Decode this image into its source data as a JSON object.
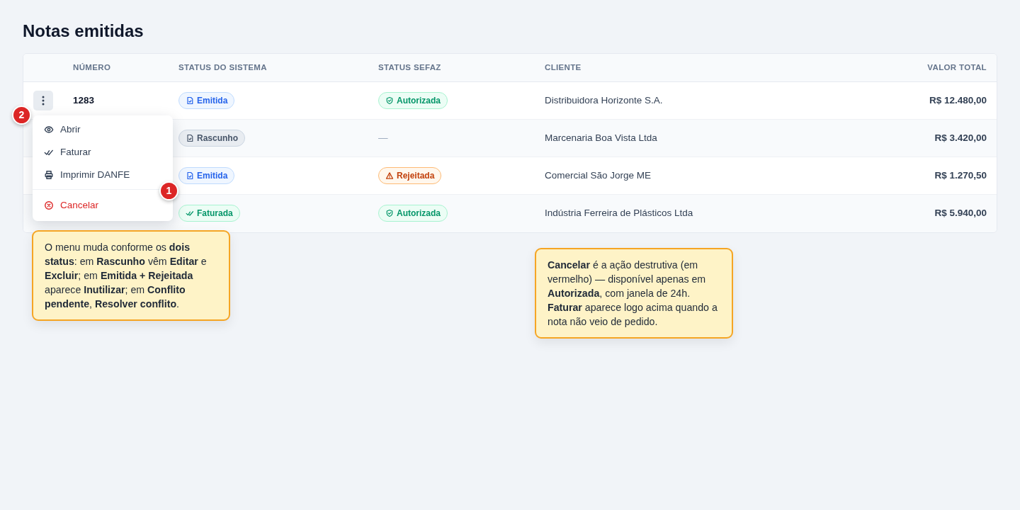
{
  "title": "Notas emitidas",
  "table": {
    "columns": [
      "",
      "NÚMERO",
      "STATUS DO SISTEMA",
      "STATUS SEFAZ",
      "CLIENTE",
      "VALOR TOTAL"
    ],
    "rows": [
      {
        "menu_open": true,
        "number": "1283",
        "system_status": {
          "kind": "emitida",
          "label": "Emitida"
        },
        "sefaz_status": {
          "kind": "autorizada",
          "label": "Autorizada"
        },
        "client": "Distribuidora Horizonte S.A.",
        "total": "R$ 12.480,00"
      },
      {
        "menu_open": false,
        "system_status": {
          "kind": "rascunho",
          "label": "Rascunho"
        },
        "sefaz_status": {
          "kind": "none",
          "label": "—"
        },
        "client": "Marcenaria Boa Vista Ltda",
        "total": "R$ 3.420,00"
      },
      {
        "menu_open": false,
        "system_status": {
          "kind": "emitida",
          "label": "Emitida"
        },
        "sefaz_status": {
          "kind": "rejeitada",
          "label": "Rejeitada"
        },
        "client": "Comercial São Jorge ME",
        "total": "R$ 1.270,50"
      },
      {
        "menu_open": false,
        "system_status": {
          "kind": "faturada",
          "label": "Faturada"
        },
        "sefaz_status": {
          "kind": "autorizada",
          "label": "Autorizada"
        },
        "client": "Indústria Ferreira de Plásticos Ltda",
        "total": "R$ 5.940,00"
      }
    ]
  },
  "menu": {
    "items": [
      {
        "kind": "eye",
        "label": "Abrir",
        "danger": false
      },
      {
        "kind": "check",
        "label": "Faturar",
        "danger": false
      },
      {
        "kind": "printer",
        "label": "Imprimir DANFE",
        "danger": false
      },
      {
        "kind": "divider"
      },
      {
        "kind": "cancel",
        "label": "Cancelar",
        "danger": true
      }
    ]
  },
  "markers": [
    "1",
    "2"
  ],
  "notes": [
    "O menu muda conforme os **dois status**: em **Rascunho** vêm **Editar** e **Excluir**; em **Emitida + Rejeitada** aparece **Inutilizar**; em **Conflito pendente**, **Resolver conflito**.",
    "**Cancelar** é a ação destrutiva (em vermelho) — disponível apenas em **Autorizada**, com janela de 24h. **Faturar** aparece logo acima quando a nota não veio de pedido."
  ]
}
